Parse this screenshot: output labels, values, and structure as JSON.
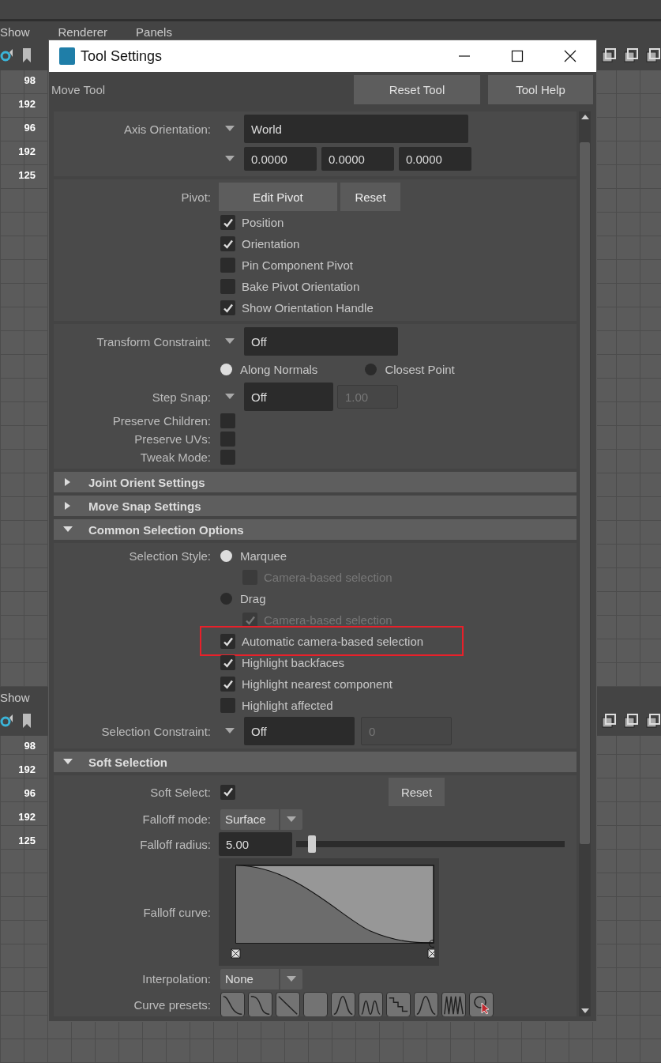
{
  "background": {
    "panels": [
      {
        "menu": [
          "Show",
          "Renderer",
          "Panels"
        ],
        "hud": [
          "98",
          "192",
          "96",
          "192",
          "125"
        ]
      },
      {
        "menu": [
          "Show"
        ],
        "hud": [
          "98",
          "192",
          "96",
          "192",
          "125"
        ]
      }
    ]
  },
  "dialog": {
    "title": "Tool Settings",
    "tool_name": "Move Tool",
    "buttons": [
      "Reset Tool",
      "Tool Help"
    ],
    "sections": [
      {
        "rows": [
          {
            "kind": "dropdown",
            "label": "Axis Orientation:",
            "value": "World"
          },
          {
            "kind": "vector",
            "values": [
              "0.0000",
              "0.0000",
              "0.0000"
            ]
          }
        ]
      },
      {
        "rows": [
          {
            "kind": "buttons",
            "label": "Pivot:",
            "buttons": [
              "Edit Pivot",
              "Reset"
            ]
          },
          {
            "kind": "checkbox",
            "text": "Position",
            "checked": true
          },
          {
            "kind": "checkbox",
            "text": "Orientation",
            "checked": true
          },
          {
            "kind": "checkbox",
            "text": "Pin Component Pivot",
            "checked": false
          },
          {
            "kind": "checkbox",
            "text": "Bake Pivot Orientation",
            "checked": false
          },
          {
            "kind": "checkbox",
            "text": "Show Orientation Handle",
            "checked": true
          }
        ]
      },
      {
        "rows": [
          {
            "kind": "dropdown",
            "label": "Transform Constraint:",
            "value": "Off"
          },
          {
            "kind": "radio-pair",
            "options": [
              {
                "text": "Along Normals",
                "selected": true
              },
              {
                "text": "Closest Point",
                "selected": false
              }
            ]
          },
          {
            "kind": "dropdown",
            "label": "Step Snap:",
            "value": "Off",
            "extra": "1.00"
          },
          {
            "kind": "label-checkbox",
            "label": "Preserve Children:",
            "checked": false
          },
          {
            "kind": "label-checkbox",
            "label": "Preserve UVs:",
            "checked": false
          },
          {
            "kind": "label-checkbox",
            "label": "Tweak Mode:",
            "checked": false
          }
        ]
      },
      {
        "title": "Joint Orient Settings",
        "expanded": false
      },
      {
        "title": "Move Snap Settings",
        "expanded": false
      },
      {
        "title": "Common Selection Options",
        "expanded": true,
        "rows": [
          {
            "kind": "radio",
            "label": "Selection Style:",
            "text": "Marquee",
            "selected": true
          },
          {
            "kind": "subcheckbox",
            "text": "Camera-based selection",
            "checked": false,
            "disabled": true
          },
          {
            "kind": "radio",
            "text": "Drag",
            "selected": false
          },
          {
            "kind": "subcheckbox",
            "text": "Camera-based selection",
            "checked": true,
            "disabled": true
          },
          {
            "kind": "checkbox",
            "text": "Automatic camera-based selection",
            "checked": true,
            "highlighted": true
          },
          {
            "kind": "checkbox",
            "text": "Highlight backfaces",
            "checked": true
          },
          {
            "kind": "checkbox",
            "text": "Highlight nearest component",
            "checked": true
          },
          {
            "kind": "checkbox",
            "text": "Highlight affected",
            "checked": false
          },
          {
            "kind": "dropdown",
            "label": "Selection Constraint:",
            "value": "Off",
            "extra": "0"
          }
        ]
      },
      {
        "title": "Soft Selection",
        "expanded": true,
        "rows": [
          {
            "kind": "label-checkbox",
            "label": "Soft Select:",
            "checked": true,
            "button": "Reset"
          },
          {
            "kind": "combo",
            "label": "Falloff mode:",
            "value": "Surface"
          },
          {
            "kind": "slider",
            "label": "Falloff radius:",
            "value": "5.00",
            "level": 0.06
          },
          {
            "kind": "curve",
            "label": "Falloff curve:"
          },
          {
            "kind": "combo",
            "label": "Interpolation:",
            "value": "None"
          },
          {
            "kind": "presets",
            "label": "Curve presets:"
          }
        ]
      }
    ]
  }
}
